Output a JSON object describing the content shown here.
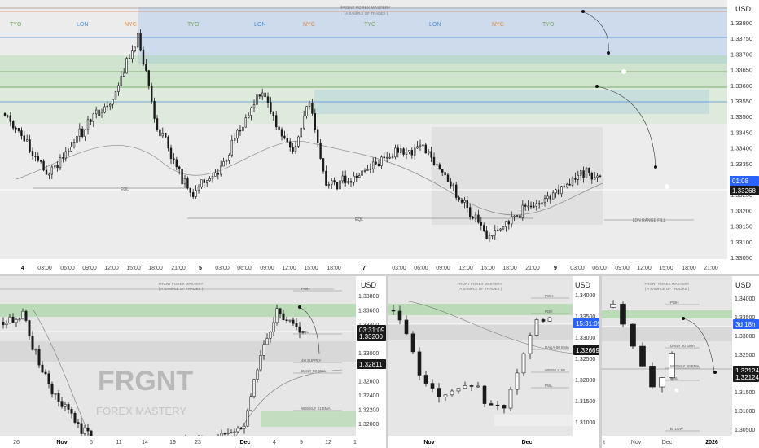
{
  "currency": "USD",
  "brand": {
    "title": "FRGNT FOREX MASTERY",
    "subtitle": "( A SAMPLE OF TRADES )",
    "watermark_big": "FRGNT",
    "watermark_small": "FOREX MASTERY"
  },
  "colors": {
    "bull_zone": "#9fd49a",
    "bear_zone": "#a9c8ee",
    "candle": "#1a1a1a",
    "countdown": "#2962ff",
    "price_tag": "#1a1a1a",
    "session_tyo": "#78a65a",
    "session_lon": "#4a8fd6",
    "session_nyc": "#e0883a"
  },
  "main": {
    "sessions": [
      {
        "label": "TYO",
        "color_key": "session_tyo"
      },
      {
        "label": "LON",
        "color_key": "session_lon"
      },
      {
        "label": "NYC",
        "color_key": "session_nyc"
      },
      {
        "label": "TYO",
        "color_key": "session_tyo"
      },
      {
        "label": "LON",
        "color_key": "session_lon"
      },
      {
        "label": "NYC",
        "color_key": "session_nyc"
      },
      {
        "label": "TYO",
        "color_key": "session_tyo"
      },
      {
        "label": "LON",
        "color_key": "session_lon"
      },
      {
        "label": "NYC",
        "color_key": "session_nyc"
      },
      {
        "label": "TYO",
        "color_key": "session_tyo"
      }
    ],
    "price_ticks": [
      "1.33800",
      "1.33750",
      "1.33700",
      "1.33650",
      "1.33600",
      "1.33550",
      "1.33500",
      "1.33450",
      "1.33400",
      "1.33350",
      "1.33300",
      "1.33250",
      "1.33200",
      "1.33150",
      "1.33100",
      "1.33050"
    ],
    "countdown": "01:08",
    "last_price": "1.33268",
    "time_ticks": [
      "4",
      "03:00",
      "06:00",
      "09:00",
      "12:00",
      "15:00",
      "18:00",
      "21:00",
      "5",
      "03:00",
      "06:00",
      "09:00",
      "12:00",
      "15:00",
      "18:00",
      "7",
      "03:00",
      "06:00",
      "09:00",
      "12:00",
      "15:00",
      "18:00",
      "21:00",
      "9",
      "03:00",
      "06:00",
      "09:00",
      "12:00",
      "15:00",
      "18:00",
      "21:00"
    ],
    "bold_ticks": [
      "4",
      "5",
      "7",
      "9"
    ],
    "eq_label": "EQL",
    "range_label": "LDN RANGE FILL"
  },
  "bottom_left": {
    "price_ticks": [
      "1.33800",
      "1.33600",
      "1.33400",
      "1.33200",
      "1.33000",
      "1.32800",
      "1.32600",
      "1.32400",
      "1.32200",
      "1.32000"
    ],
    "countdown": "03:31:09",
    "last_price": "1.33200",
    "tag_price": "1.32811",
    "time_ticks": [
      "26",
      "Nov",
      "6",
      "11",
      "14",
      "19",
      "23",
      "Dec",
      "4",
      "9",
      "12",
      "1"
    ],
    "annotations": [
      "PWH",
      "EQL",
      "4H SUPPLY",
      "DAILY 50 EMA",
      "WEEKLY 21 EMA"
    ]
  },
  "bottom_mid": {
    "price_ticks": [
      "1.34000",
      "1.33500",
      "1.33000",
      "1.32500",
      "1.32000",
      "1.31500",
      "1.31000"
    ],
    "countdown": "15:31:09",
    "tag_price": "1.32669",
    "time_ticks": [
      "Nov",
      "Dec"
    ],
    "annotations": [
      "PWH",
      "PDH",
      "DAILY 50 EMA",
      "WEEKLY 50",
      "PWL"
    ]
  },
  "bottom_right": {
    "price_ticks": [
      "1.34000",
      "1.33500",
      "1.33000",
      "1.32500",
      "1.32000",
      "1.31500",
      "1.31000",
      "1.30500"
    ],
    "countdown": "3d 18h",
    "tag_price": "1.32124",
    "tag_price2": "1.32124",
    "time_ticks": [
      "t",
      "Nov",
      "Dec",
      "2026"
    ],
    "annotations": [
      "PWH",
      "DAILY 50 EMA",
      "WEEKLY 50 EMA",
      "PWL",
      "B. LOW"
    ]
  }
}
